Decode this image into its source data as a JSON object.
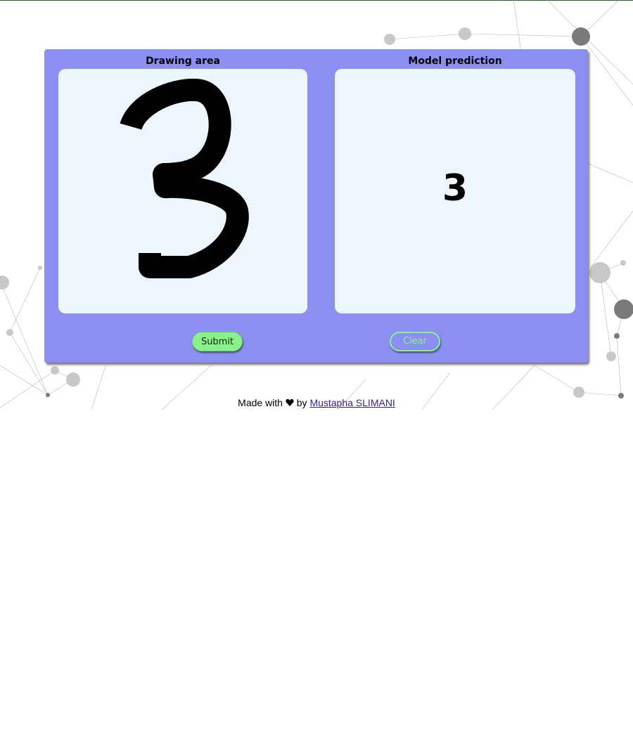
{
  "panel": {
    "drawing_title": "Drawing area",
    "prediction_title": "Model prediction",
    "prediction_value": "3"
  },
  "buttons": {
    "submit_label": "Submit",
    "clear_label": "Clear"
  },
  "footer": {
    "prefix": "Made with",
    "icon": "heart-icon",
    "middle": "by",
    "author": "Mustapha SLIMANI"
  },
  "colors": {
    "panel": "#8c8ff2",
    "canvas": "#eef6fd",
    "submit": "#8af28a",
    "link": "#3d1a8c"
  }
}
